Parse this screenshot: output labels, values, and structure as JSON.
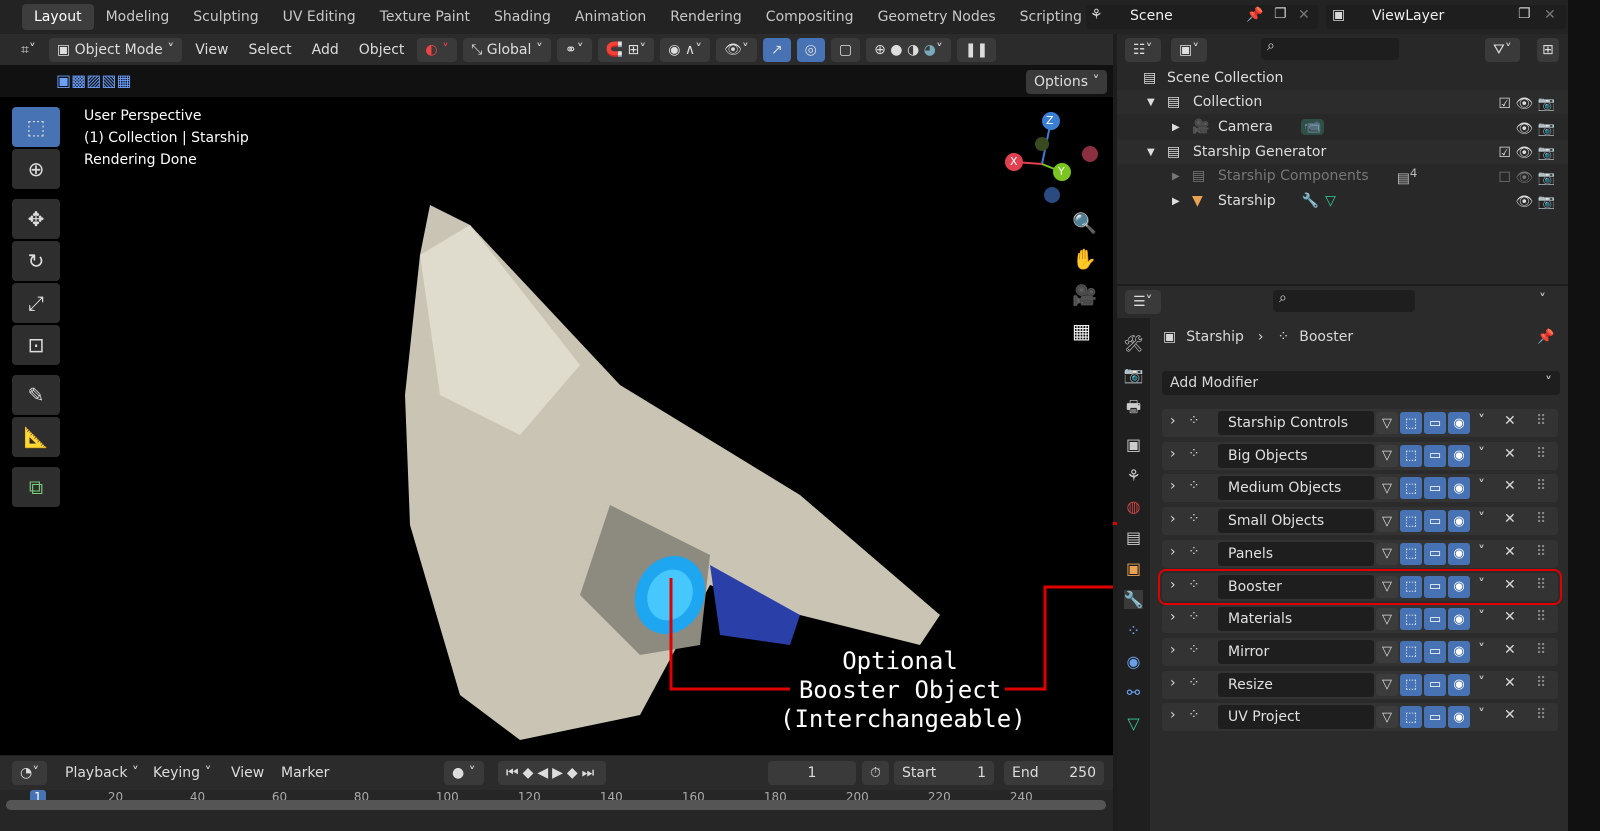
{
  "workspace_tabs": [
    "Layout",
    "Modeling",
    "Sculpting",
    "UV Editing",
    "Texture Paint",
    "Shading",
    "Animation",
    "Rendering",
    "Compositing",
    "Geometry Nodes",
    "Scripting"
  ],
  "add_workspace": "+",
  "scene": {
    "name": "Scene",
    "view_layer": "ViewLayer"
  },
  "header": {
    "mode": "Object Mode",
    "menus": [
      "View",
      "Select",
      "Add",
      "Object"
    ],
    "transform": "Global",
    "options": "Options"
  },
  "viewport": {
    "line1": "User Perspective",
    "line2": "(1) Collection | Starship",
    "line3": "Rendering Done",
    "gizmo": {
      "x": "X",
      "y": "Y",
      "z": "Z"
    }
  },
  "annotation": {
    "line1": "Optional",
    "line2": "Booster Object",
    "line3": "(Interchangeable)",
    "color": "#e00000"
  },
  "timeline": {
    "menus": [
      "Playback",
      "Keying",
      "View",
      "Marker"
    ],
    "current_frame": "1",
    "start_label": "Start",
    "start": "1",
    "end_label": "End",
    "end": "250",
    "ticks": [
      "1",
      "20",
      "40",
      "60",
      "80",
      "100",
      "120",
      "140",
      "160",
      "180",
      "200",
      "220",
      "240"
    ]
  },
  "outliner": {
    "root": "Scene Collection",
    "items": [
      {
        "label": "Collection",
        "depth": 0
      },
      {
        "label": "Camera",
        "depth": 1
      },
      {
        "label": "Starship Generator",
        "depth": 0
      },
      {
        "label": "Starship Components",
        "depth": 1,
        "badge": "4"
      },
      {
        "label": "Starship",
        "depth": 1
      }
    ]
  },
  "properties": {
    "breadcrumb": {
      "object": "Starship",
      "modifier": "Booster"
    },
    "add_modifier": "Add Modifier",
    "modifiers": [
      {
        "name": "Starship Controls"
      },
      {
        "name": "Big Objects"
      },
      {
        "name": "Medium Objects"
      },
      {
        "name": "Small Objects"
      },
      {
        "name": "Panels"
      },
      {
        "name": "Booster",
        "highlighted": true
      },
      {
        "name": "Materials"
      },
      {
        "name": "Mirror"
      },
      {
        "name": "Resize"
      },
      {
        "name": "UV Project"
      }
    ]
  }
}
